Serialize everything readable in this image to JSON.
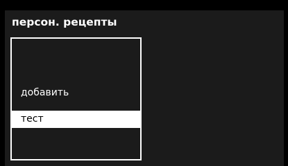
{
  "screen": {
    "title": "персон. рецепты"
  },
  "menu": {
    "items": [
      {
        "label": "добавить",
        "selected": false
      },
      {
        "label": "тест",
        "selected": true
      }
    ]
  },
  "colors": {
    "background": "#000000",
    "panel": "#1b1b1b",
    "text": "#ffffff",
    "selection": "#ffffff",
    "selection_text": "#000000"
  }
}
